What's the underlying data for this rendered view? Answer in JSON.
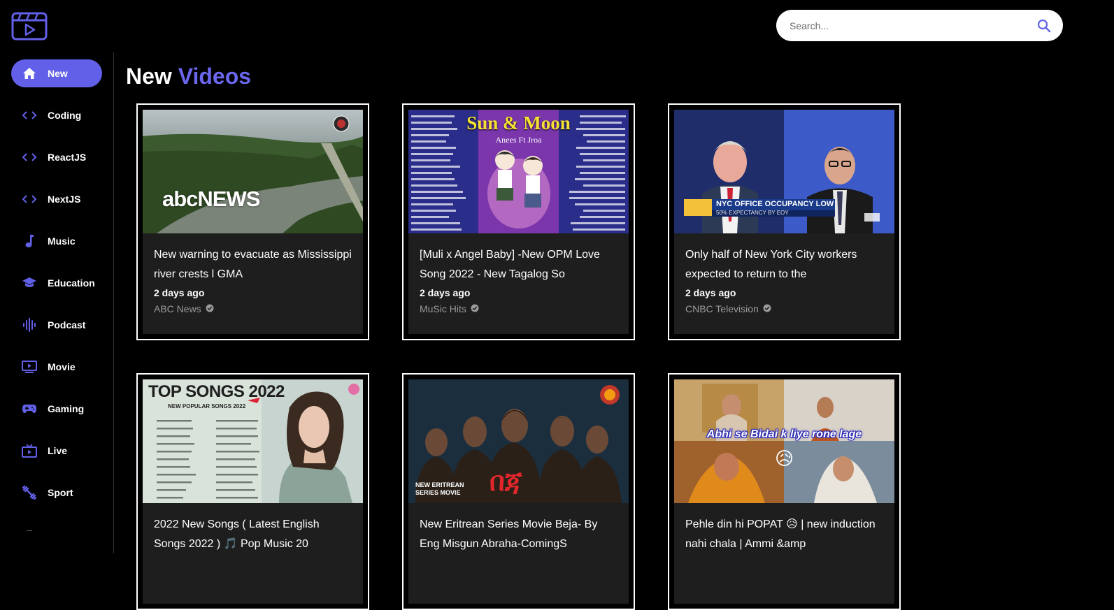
{
  "search": {
    "placeholder": "Search..."
  },
  "sidebar": {
    "items": [
      {
        "label": "New",
        "icon": "home-icon",
        "active": true
      },
      {
        "label": "Coding",
        "icon": "code-icon"
      },
      {
        "label": "ReactJS",
        "icon": "code-icon"
      },
      {
        "label": "NextJS",
        "icon": "code-icon"
      },
      {
        "label": "Music",
        "icon": "music-note-icon"
      },
      {
        "label": "Education",
        "icon": "graduation-cap-icon"
      },
      {
        "label": "Podcast",
        "icon": "podcast-icon"
      },
      {
        "label": "Movie",
        "icon": "movie-icon"
      },
      {
        "label": "Gaming",
        "icon": "gamepad-icon"
      },
      {
        "label": "Live",
        "icon": "live-tv-icon"
      },
      {
        "label": "Sport",
        "icon": "dumbbell-icon"
      }
    ]
  },
  "main": {
    "title_part1": "New",
    "title_part2": "Videos",
    "videos": [
      {
        "title": "New warning to evacuate as Mississippi river crests l GMA",
        "time": "2 days ago",
        "channel": "ABC News",
        "thumb_text": "abcNEWS"
      },
      {
        "title": "[Muli x Angel Baby] -New OPM Love Song 2022 - New Tagalog So",
        "time": "2 days ago",
        "channel": "MuSic Hits",
        "thumb_text": "Sun & Moon",
        "thumb_sub": "Anees Ft Jroa"
      },
      {
        "title": "Only half of New York City workers expected to return to the",
        "time": "2 days ago",
        "channel": "CNBC Television",
        "thumb_text": "NYC OFFICE OCCUPANCY LOW",
        "thumb_sub": "50% EXPECTANCY BY EOY"
      },
      {
        "title": "2022 New Songs ( Latest English Songs 2022 ) 🎵 Pop Music 20",
        "time": "",
        "channel": "",
        "thumb_text": "TOP SONGS 2022",
        "thumb_sub": "NEW POPULAR SONGS 2022"
      },
      {
        "title": "New Eritrean Series Movie Beja- By Eng Misgun Abraha-ComingS",
        "time": "",
        "channel": "",
        "thumb_text": "በጃ",
        "thumb_sub": "NEW ERITREAN SERIES MOVIE"
      },
      {
        "title": "Pehle din hi POPAT 😥 | new induction nahi chala | Ammi &amp",
        "time": "",
        "channel": "",
        "thumb_text": "Abhi se Bidai k liye rone lage"
      }
    ]
  },
  "colors": {
    "accent": "#6260e8",
    "card_bg": "#1e1e1e",
    "muted": "#9a9a9a"
  }
}
